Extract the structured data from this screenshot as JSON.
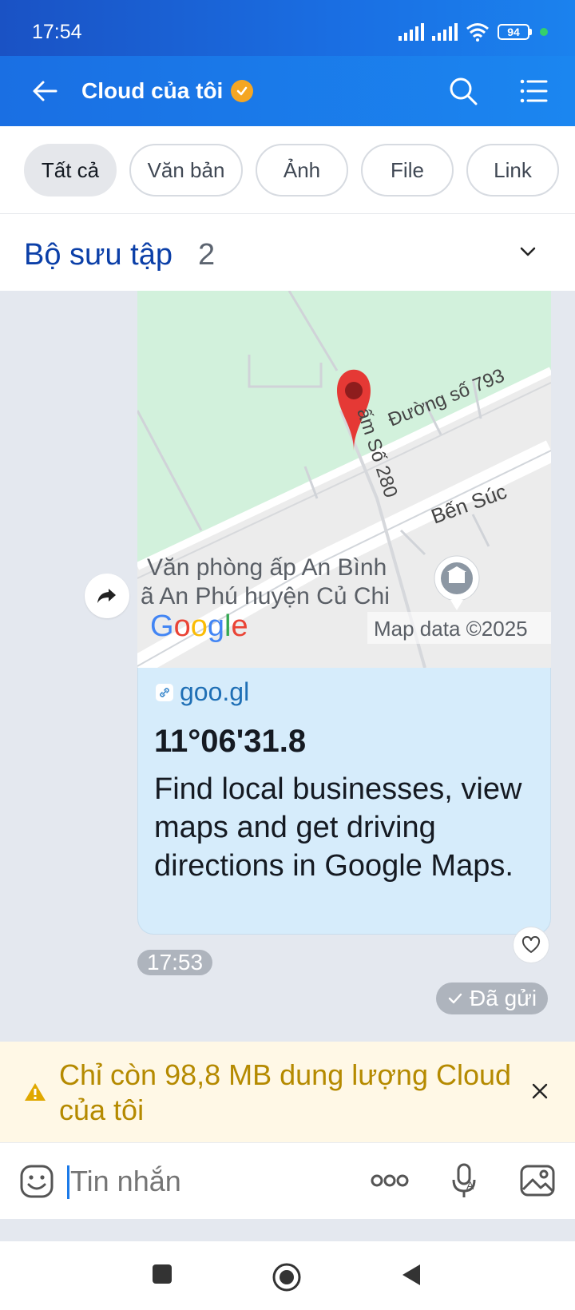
{
  "status": {
    "time": "17:54",
    "battery": "94"
  },
  "header": {
    "title": "Cloud của tôi"
  },
  "filters": [
    {
      "label": "Tất cả",
      "active": true
    },
    {
      "label": "Văn bản"
    },
    {
      "label": "Ảnh"
    },
    {
      "label": "File"
    },
    {
      "label": "Link"
    }
  ],
  "collection": {
    "label": "Bộ sưu tập",
    "count": "2"
  },
  "message": {
    "map": {
      "road_labels": [
        "Đường số 793",
        "ấm Số 280",
        "Bến Súc"
      ],
      "place_name_line1": "Văn phòng ấp An Bình",
      "place_name_line2": "ã An Phú huyện Củ Chi",
      "brand": "Google",
      "attribution": "Map data ©2025"
    },
    "link": {
      "domain": "goo.gl",
      "title": "11°06'31.8",
      "description": "Find local businesses, view maps and get driving directions in Google Maps."
    },
    "time": "17:53",
    "status": "Đã gửi"
  },
  "warning": {
    "text": "Chỉ còn 98,8 MB dung lượng Cloud của tôi"
  },
  "input": {
    "placeholder": "Tin nhắn"
  },
  "colors": {
    "header": "#1a6fe3",
    "link_panel": "#d6ecfb",
    "warning_text": "#b58a00"
  }
}
